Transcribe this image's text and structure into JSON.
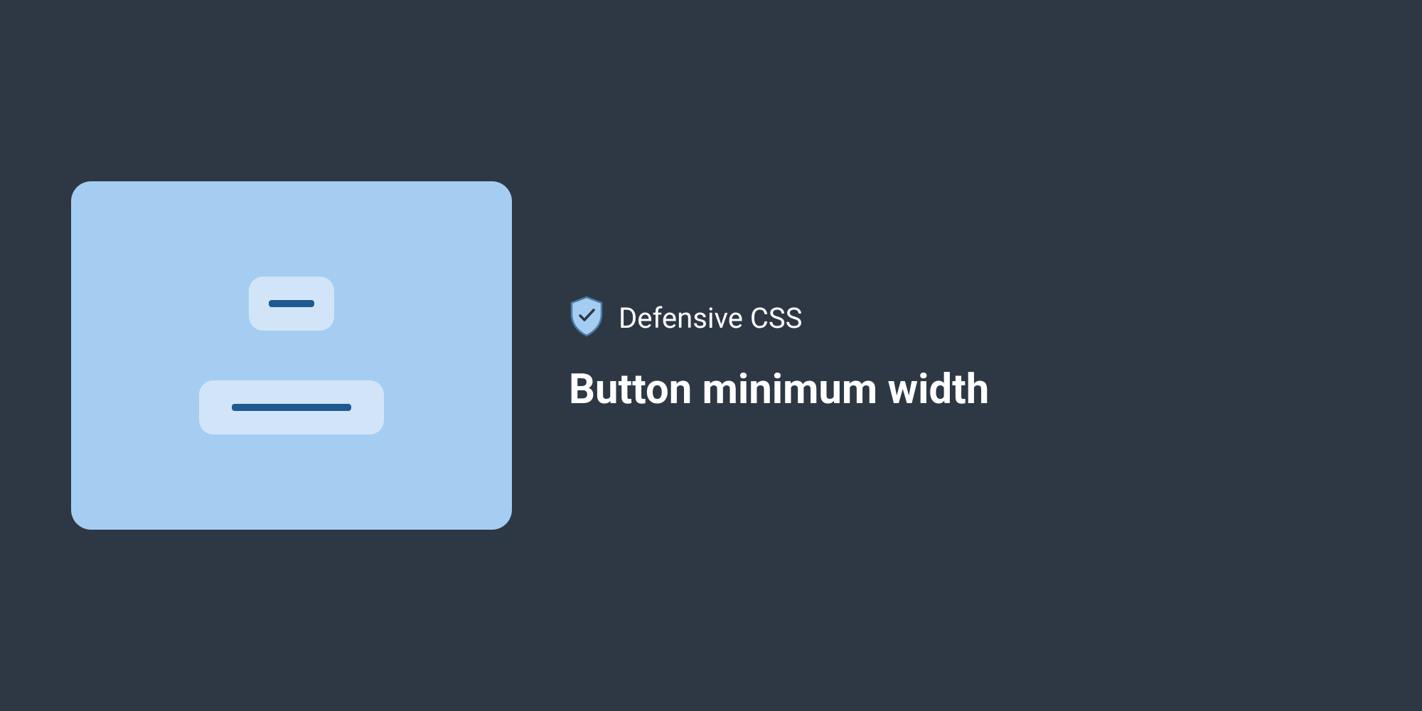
{
  "brand": {
    "name": "Defensive CSS"
  },
  "title": "Button minimum width",
  "colors": {
    "background": "#2d3844",
    "card": "#a5cdf1",
    "button": "#d2e5f8",
    "accent": "#1e5a8e",
    "text": "#ffffff"
  }
}
